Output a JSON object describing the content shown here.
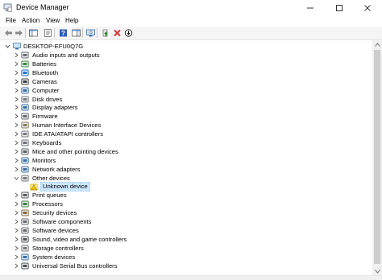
{
  "window": {
    "title": "Device Manager"
  },
  "menu": [
    "File",
    "Action",
    "View",
    "Help"
  ],
  "toolbar": {
    "buttons": [
      "back-icon",
      "forward-icon",
      "show-hide-console-tree-icon",
      "properties-icon",
      "help-icon",
      "action-pane-icon",
      "scan-hardware-icon",
      "update-driver-icon",
      "uninstall-device-icon",
      "disable-device-icon"
    ]
  },
  "tree": {
    "root": "DESKTOP-EFU0Q7G",
    "categories": [
      "Audio inputs and outputs",
      "Batteries",
      "Bluetooth",
      "Cameras",
      "Computer",
      "Disk drives",
      "Display adapters",
      "Firmware",
      "Human Interface Devices",
      "IDE ATA/ATAPI controllers",
      "Keyboards",
      "Mice and other pointing devices",
      "Monitors",
      "Network adapters",
      "Other devices",
      "Unknown device",
      "Print queues",
      "Processors",
      "Security devices",
      "Software components",
      "Software devices",
      "Sound, video and game controllers",
      "Storage controllers",
      "System devices",
      "Universal Serial Bus controllers"
    ]
  },
  "colors": {
    "selection": "#cce8ff",
    "uninstall": "#d13438",
    "update": "#107c10"
  }
}
